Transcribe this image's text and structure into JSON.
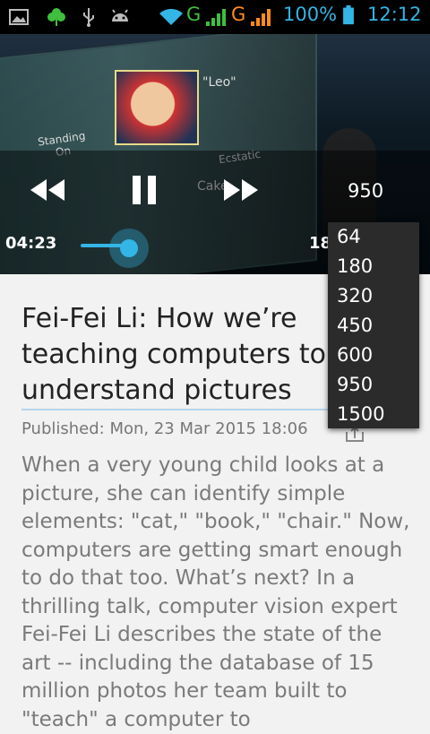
{
  "status_bar": {
    "icons": [
      "image-icon",
      "clover-icon",
      "usb-icon",
      "android-debug-icon",
      "wifi-icon",
      "signal-icon",
      "signal-icon"
    ],
    "network1": "G",
    "network2": "G",
    "battery_percent": "100%",
    "clock": "12:12",
    "accent": "#33b5e5"
  },
  "video": {
    "slide_labels": {
      "leo": "\"Leo\"",
      "standing": "Standing",
      "on": "On",
      "ecstatic": "Ecstatic",
      "cake": "Cake"
    },
    "current_time": "04:23",
    "partial_time": "18",
    "quality_selected": "950",
    "progress_fraction": 0.05
  },
  "quality_dropdown": {
    "options": [
      "64",
      "180",
      "320",
      "450",
      "600",
      "950",
      "1500"
    ]
  },
  "article": {
    "title": "Fei-Fei Li: How we’re teaching computers to understand pictures",
    "published": "Published: Mon, 23 Mar 2015 18:06",
    "body": "When a very young child looks at a picture, she can identify simple elements: \"cat,\" \"book,\" \"chair.\" Now, computers are getting smart enough to do that too. What’s next? In a thrilling talk, computer vision expert Fei-Fei Li describes the state of the art  -- including the database of 15 million photos her team built to \"teach\" a computer to"
  }
}
